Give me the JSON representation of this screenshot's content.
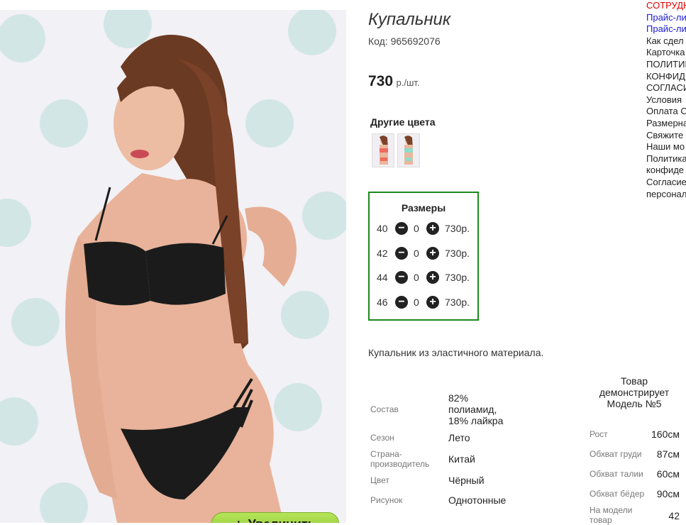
{
  "product": {
    "title": "Купальник",
    "code": "Код: 965692076",
    "price_amount": "730",
    "price_unit": "р./шт."
  },
  "photo": {
    "zoom_label": "Увеличить",
    "zoom_icon": "plus-icon"
  },
  "other_colors": {
    "title": "Другие цвета",
    "swatches": [
      "coral-swimsuit",
      "mint-swimsuit"
    ]
  },
  "sizes": {
    "title": "Размеры",
    "rows": [
      {
        "size": "40",
        "qty": "0",
        "price": "730р."
      },
      {
        "size": "42",
        "qty": "0",
        "price": "730р."
      },
      {
        "size": "44",
        "qty": "0",
        "price": "730р."
      },
      {
        "size": "46",
        "qty": "0",
        "price": "730р."
      }
    ]
  },
  "description": "Купальник из эластичного материала.",
  "specs": [
    {
      "label": "Состав",
      "value": "82% полиамид, 18% лайкра"
    },
    {
      "label": "Сезон",
      "value": "Лето"
    },
    {
      "label": "Страна-производитель",
      "value": "Китай"
    },
    {
      "label": "Цвет",
      "value": "Чёрный"
    },
    {
      "label": "Рисунок",
      "value": "Однотонные"
    }
  ],
  "model": {
    "heading": "Товар демонстрирует Модель №5",
    "rows": [
      {
        "label": "Рост",
        "value": "160см"
      },
      {
        "label": "Обхват груди",
        "value": "87см"
      },
      {
        "label": "Обхват талии",
        "value": "60см"
      },
      {
        "label": "Обхват бёдер",
        "value": "90см"
      },
      {
        "label": "На модели товар",
        "value": "42"
      }
    ]
  },
  "sidebar": {
    "links": [
      {
        "text": "СОТРУДН",
        "color": "#e00000"
      },
      {
        "text": "Прайс-ли",
        "color": "#1a1ad0"
      },
      {
        "text": "Прайс-ли",
        "color": "#1a1ad0"
      },
      {
        "text": "Как сдел",
        "color": "#222222"
      },
      {
        "text": "Карточка",
        "color": "#222222"
      },
      {
        "text": "ПОЛИТИК",
        "color": "#222222"
      },
      {
        "text": "КОНФИД",
        "color": "#222222"
      },
      {
        "text": "СОГЛАСИ",
        "color": "#222222"
      },
      {
        "text": "Условия",
        "color": "#222222"
      },
      {
        "text": "Оплата С",
        "color": "#222222"
      },
      {
        "text": "Размерна",
        "color": "#222222"
      },
      {
        "text": "Свяжите",
        "color": "#222222"
      },
      {
        "text": "Наши мо",
        "color": "#222222"
      },
      {
        "text": "Политика",
        "color": "#222222"
      },
      {
        "text": "конфиде",
        "color": "#222222"
      },
      {
        "text": "Согласие",
        "color": "#222222"
      },
      {
        "text": "персонал",
        "color": "#222222"
      }
    ]
  }
}
